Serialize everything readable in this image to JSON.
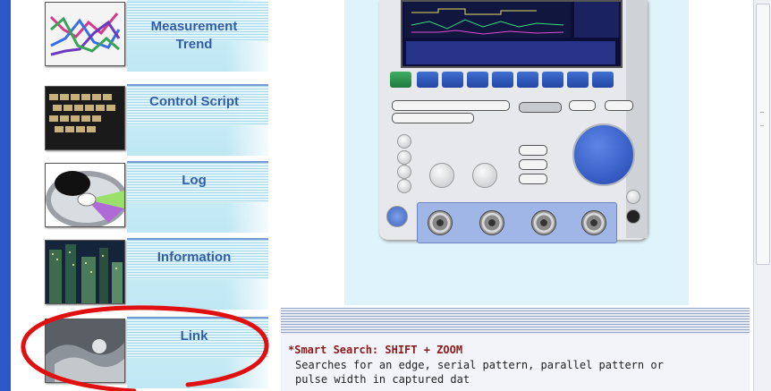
{
  "sidebar": {
    "items": [
      {
        "label_line1": "Measurement",
        "label_line2": "Trend",
        "thumb_icon": "trend-graph-icon"
      },
      {
        "label_line1": "Control Script",
        "label_line2": "",
        "thumb_icon": "keyboard-icon"
      },
      {
        "label_line1": "Log",
        "label_line2": "",
        "thumb_icon": "disc-icon"
      },
      {
        "label_line1": "Information",
        "label_line2": "",
        "thumb_icon": "city-night-icon"
      },
      {
        "label_line1": "Link",
        "label_line2": "",
        "thumb_icon": "link-photo-icon"
      }
    ]
  },
  "content": {
    "feature_title": "*Smart Search: SHIFT + ZOOM",
    "feature_desc_line1": "Searches for an edge, serial pattern, parallel pattern or",
    "feature_desc_line2": "pulse width in captured dat"
  },
  "colors": {
    "accent_blue": "#2b57c8",
    "label_text": "#2e5ca8",
    "highlight_red": "#e01010",
    "title_red": "#8b1a1a"
  }
}
